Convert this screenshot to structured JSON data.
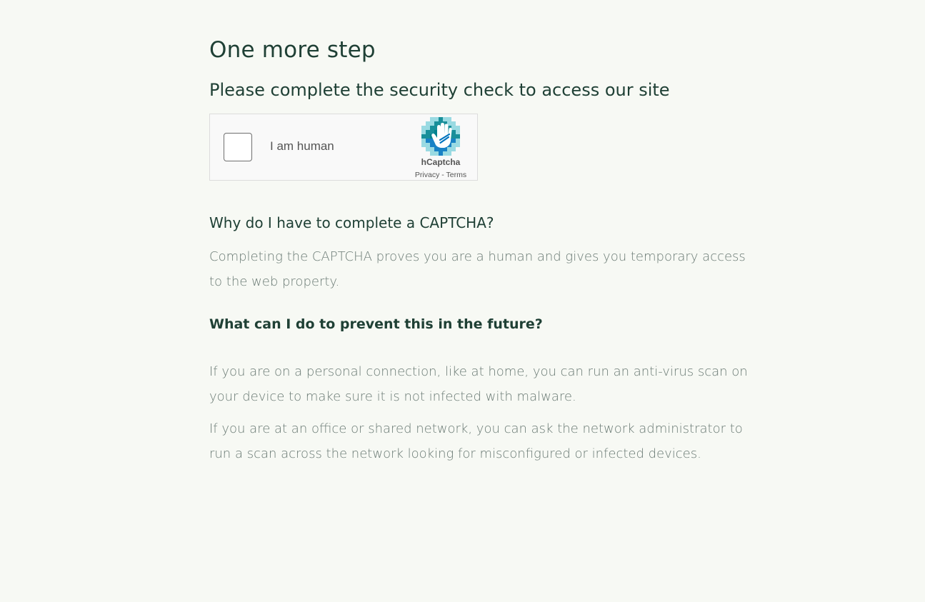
{
  "page": {
    "title": "One more step",
    "subtitle": "Please complete the security check to access our site"
  },
  "captcha": {
    "checkbox_label": "I am human",
    "brand": "hCaptcha",
    "privacy_link": "Privacy",
    "separator": " - ",
    "terms_link": "Terms",
    "logo_icon": "hcaptcha-hand-logo-icon",
    "colors": {
      "logo_primary": "#00838f",
      "logo_secondary": "#0074bf",
      "logo_light": "#4dc1d0"
    }
  },
  "faq": [
    {
      "question": "Why do I have to complete a CAPTCHA?",
      "answer": "Completing the CAPTCHA proves you are a human and gives you temporary access to the web property."
    },
    {
      "question": "What can I do to prevent this in the future?",
      "answers": [
        "If you are on a personal connection, like at home, you can run an anti-virus scan on your device to make sure it is not infected with malware.",
        "If you are at an office or shared network, you can ask the network administrator to run a scan across the network looking for misconfigured or infected devices."
      ]
    }
  ]
}
